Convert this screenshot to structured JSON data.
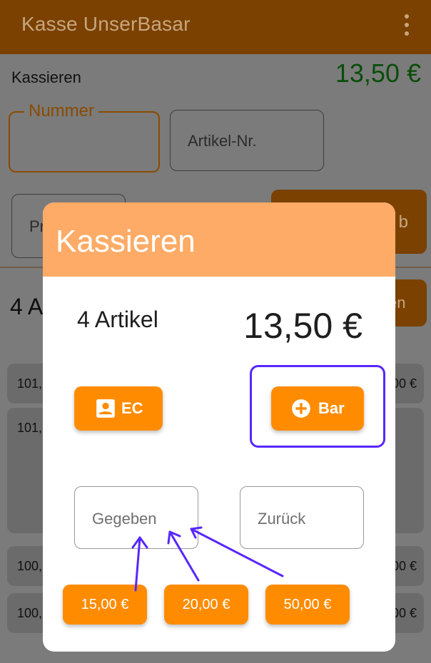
{
  "appbar": {
    "title": "Kasse UnserBasar",
    "menu_icon": "more-vert-icon"
  },
  "background": {
    "kassieren_label": "Kassieren",
    "total": "13,50 €",
    "nummer_label": "Nummer",
    "artikel_placeholder": "Artikel-Nr.",
    "preis_placeholder": "Pr",
    "add_button_fragment": "b",
    "count_fragment": "4 A",
    "small_button_fragment": "en",
    "rows": [
      {
        "left": "101,",
        "right": "00 €"
      },
      {
        "left": "101,",
        "right": ""
      },
      {
        "left": "100,",
        "right": "00 €"
      },
      {
        "left": "100,",
        "right": "00 €"
      }
    ]
  },
  "dialog": {
    "title": "Kassieren",
    "items_label": "4 Artikel",
    "amount": "13,50 €",
    "ec_button": {
      "label": "EC",
      "icon": "contact-card-icon"
    },
    "bar_button": {
      "label": "Bar",
      "icon": "plus-circle-icon"
    },
    "gegeben_placeholder": "Gegeben",
    "zurueck_placeholder": "Zurück",
    "quick_amounts": [
      "15,00 €",
      "20,00 €",
      "50,00 €"
    ]
  },
  "colors": {
    "accent": "#ff8c00",
    "header": "#fdab66",
    "appbar_dimmed": "#7a4100",
    "highlight": "#5727ff",
    "total_green_dimmed": "#0a4d0a"
  }
}
